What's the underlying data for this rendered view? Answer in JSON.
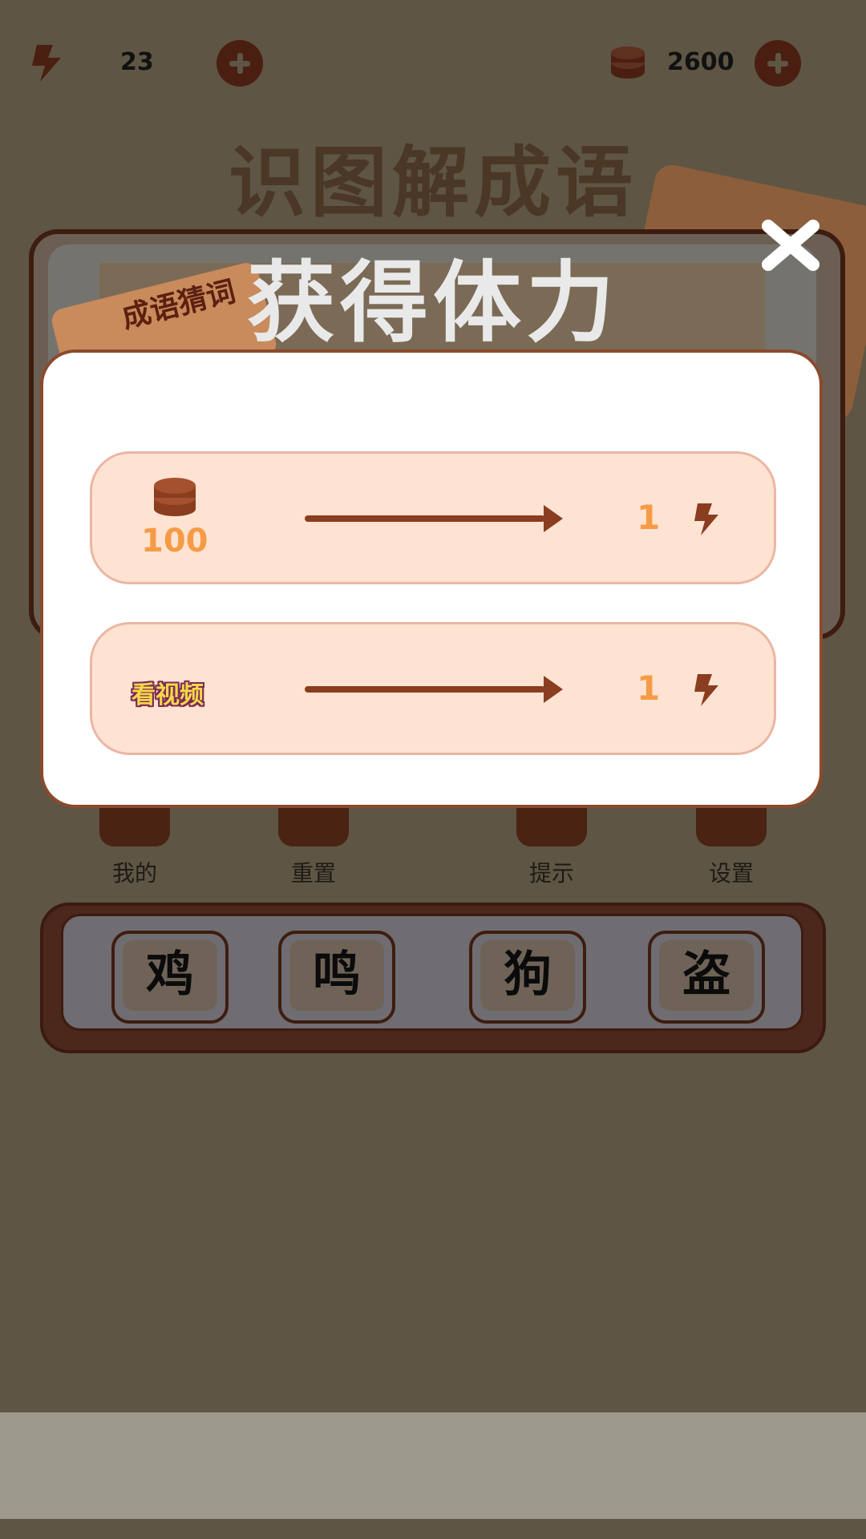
{
  "top_bar": {
    "energy_icon": "lightning-icon",
    "energy_value": "23",
    "coins_icon": "coin-stack-icon",
    "coins_value": "2600",
    "add_icon": "plus-circle-icon"
  },
  "game_title": "识图解成语",
  "book_label": "成语猜词",
  "popup": {
    "title": "获得体力",
    "close_icon": "close-icon",
    "options": [
      {
        "cost_icon": "coin-stack-icon",
        "cost": "100",
        "arrow_icon": "arrow-right-icon",
        "reward": "1",
        "reward_icon": "lightning-icon"
      },
      {
        "cost_label": "看视频",
        "arrow_icon": "arrow-right-icon",
        "reward": "1",
        "reward_icon": "lightning-icon"
      }
    ]
  },
  "actions": [
    {
      "label": "我的",
      "icon": "smile-icon"
    },
    {
      "label": "重置",
      "icon": "refresh-icon"
    },
    {
      "label": "提示",
      "icon": "lightbulb-icon"
    },
    {
      "label": "设置",
      "icon": "gear-icon"
    }
  ],
  "tiles": [
    "鸡",
    "鸣",
    "狗",
    "盗"
  ],
  "colors": {
    "background_dim": "#5e5544",
    "brown": "#8b3d20",
    "dark_brown": "#4a1f12",
    "orange": "#f69b45",
    "option_fill": "#ffe3d2"
  }
}
